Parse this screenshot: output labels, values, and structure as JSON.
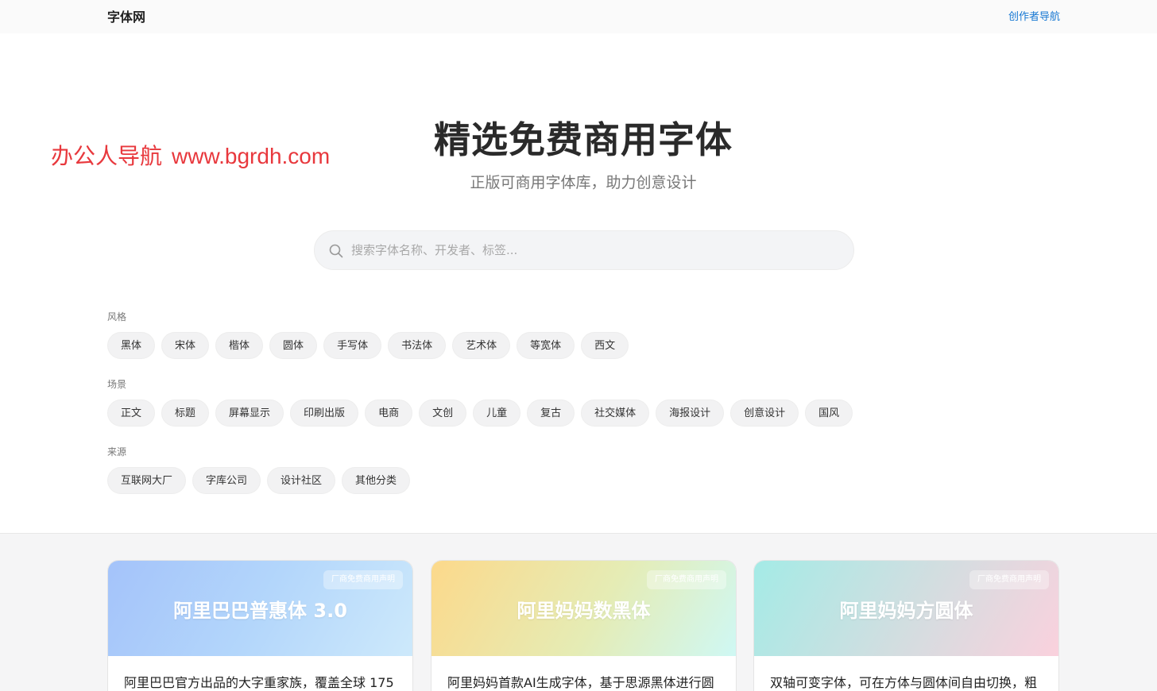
{
  "header": {
    "logo": "字体网",
    "creator_link": "创作者导航"
  },
  "watermark": {
    "name": "办公人导航",
    "url": "www.bgrdh.com"
  },
  "hero": {
    "title": "精选免费商用字体",
    "subtitle": "正版可商用字体库，助力创意设计"
  },
  "search": {
    "placeholder": "搜索字体名称、开发者、标签..."
  },
  "filters": {
    "style": {
      "label": "风格",
      "chips": [
        "黑体",
        "宋体",
        "楷体",
        "圆体",
        "手写体",
        "书法体",
        "艺术体",
        "等宽体",
        "西文"
      ]
    },
    "scene": {
      "label": "场景",
      "chips": [
        "正文",
        "标题",
        "屏幕显示",
        "印刷出版",
        "电商",
        "文创",
        "儿童",
        "复古",
        "社交媒体",
        "海报设计",
        "创意设计",
        "国风"
      ]
    },
    "source": {
      "label": "来源",
      "chips": [
        "互联网大厂",
        "字库公司",
        "设计社区",
        "其他分类"
      ]
    }
  },
  "cards": [
    {
      "badge": "厂商免费商用声明",
      "title": "阿里巴巴普惠体 3.0",
      "desc": "阿里巴巴官方出品的大字重家族，覆盖全球 175"
    },
    {
      "badge": "厂商免费商用声明",
      "title": "阿里妈妈数黑体",
      "desc": "阿里妈妈首款AI生成字体，基于思源黑体进行圆"
    },
    {
      "badge": "厂商免费商用声明",
      "title": "阿里妈妈方圆体",
      "desc": "双轴可变字体，可在方体与圆体间自由切换，粗"
    }
  ],
  "colors": {
    "link": "#1677d2",
    "watermark": "#e8383d",
    "chip_bg": "#f2f2f3"
  }
}
